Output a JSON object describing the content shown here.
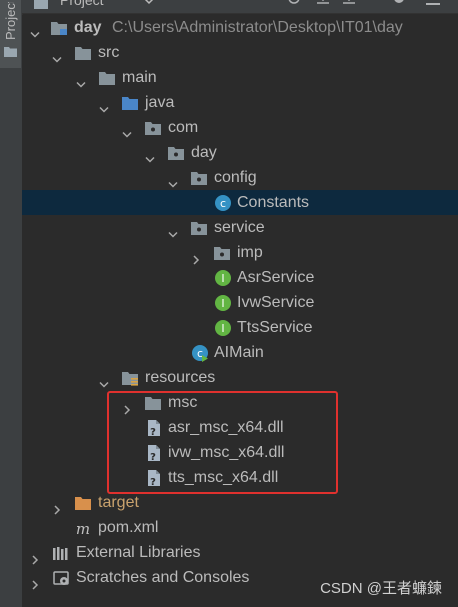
{
  "tool_window": {
    "tab_label": "Project",
    "header_title": "Project",
    "colors": {
      "background": "#2b2b2b",
      "selection": "#0d293e",
      "folder": "#87939a",
      "source_folder": "#4a86c8",
      "class_icon": "#3592c4",
      "interface_icon": "#62b543",
      "excluded_folder": "#d8904c",
      "annotation": "#e0312e"
    }
  },
  "tree": {
    "project": {
      "name": "day",
      "path": "C:\\Users\\Administrator\\Desktop\\IT01\\day"
    },
    "src": "src",
    "main": "main",
    "java": "java",
    "com": "com",
    "day": "day",
    "config": "config",
    "constants": "Constants",
    "service": "service",
    "imp": "imp",
    "asr_service": "AsrService",
    "ivw_service": "IvwService",
    "tts_service": "TtsService",
    "aimain": "AIMain",
    "resources": "resources",
    "msc": "msc",
    "asr_dll": "asr_msc_x64.dll",
    "ivw_dll": "ivw_msc_x64.dll",
    "tts_dll": "tts_msc_x64.dll",
    "target": "target",
    "pom": "pom.xml",
    "external_libraries": "External Libraries",
    "scratches": "Scratches and Consoles"
  },
  "watermark": "CSDN @王者蠊鍊"
}
